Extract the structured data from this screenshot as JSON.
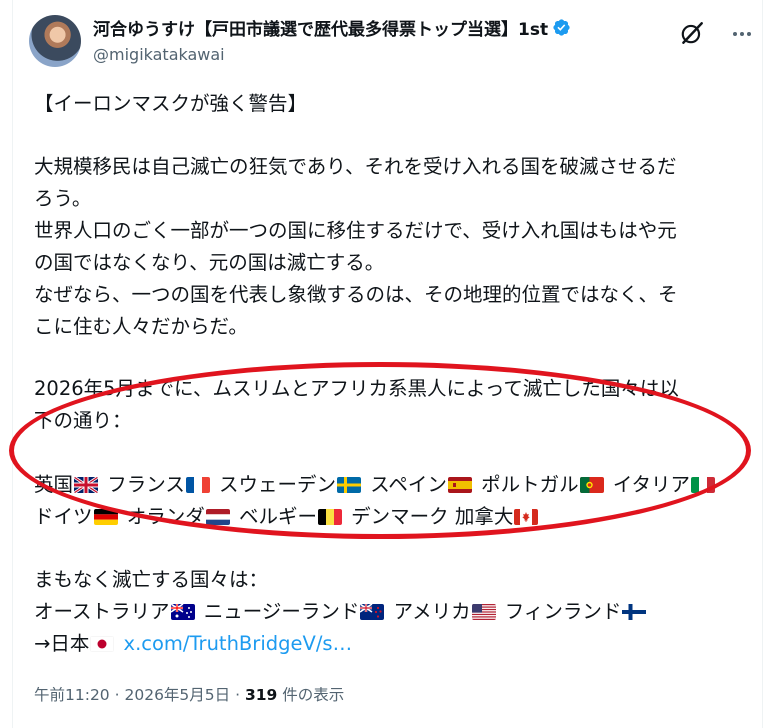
{
  "author": {
    "name": "河合ゆうすけ【戸田市議選で歴代最多得票トップ当選】1st",
    "handle": "@migikatakawai"
  },
  "post": {
    "title_line": "【イーロンマスクが強く警告】",
    "p1_l1": "大規模移民は自己滅亡の狂気であり、それを受け入れる国を破滅させるだ",
    "p1_l2": "ろう。",
    "p1_l3": "世界人口のごく一部が一つの国に移住するだけで、受け入れ国はもはや元",
    "p1_l4": "の国ではなくなり、元の国は滅亡する。",
    "p1_l5": "なぜなら、一つの国を代表し象徴するのは、その地理的位置ではなく、そ",
    "p1_l6": "こに住む人々だからだ。",
    "p2_l1": "2026年5月までに、ムスリムとアフリカ系黒人によって滅亡した国々は以",
    "p2_l2": "下の通り：",
    "fallen_line1": [
      {
        "name": "英国",
        "flag": "uk"
      },
      {
        "name": "フランス",
        "flag": "france"
      },
      {
        "name": "スウェーデン",
        "flag": "sweden"
      },
      {
        "name": "スペイン",
        "flag": "spain"
      },
      {
        "name": "ポルトガル",
        "flag": "portugal"
      },
      {
        "name": "イタリア",
        "flag": "italy"
      }
    ],
    "fallen_line2": [
      {
        "name": "ドイツ",
        "flag": "germany"
      },
      {
        "name": "オランダ",
        "flag": "netherlands"
      },
      {
        "name": "ベルギー",
        "flag": "belgium"
      },
      {
        "name": "デンマーク",
        "flag": ""
      },
      {
        "name": "加拿大",
        "flag": "canada"
      }
    ],
    "p3_l1": "まもなく滅亡する国々は：",
    "soon_line1": [
      {
        "name": "オーストラリア",
        "flag": "australia"
      },
      {
        "name": "ニュージーランド",
        "flag": "newzealand"
      },
      {
        "name": "アメリカ",
        "flag": "usa"
      },
      {
        "name": "フィンランド",
        "flag": "finland"
      }
    ],
    "soon_line2_prefix": "→日本",
    "soon_line2_flag": "japan",
    "link_text": "x.com/TruthBridgeV/s…"
  },
  "meta": {
    "time": "午前11:20",
    "sep": "·",
    "date": "2026年5月5日",
    "views": "319",
    "views_label": "件の表示"
  },
  "colors": {
    "link": "#1d9bf0",
    "highlight_circle": "#e0141e",
    "secondary_text": "#536471"
  },
  "icons": [
    "verified-badge-icon",
    "grok-icon",
    "more-icon"
  ]
}
